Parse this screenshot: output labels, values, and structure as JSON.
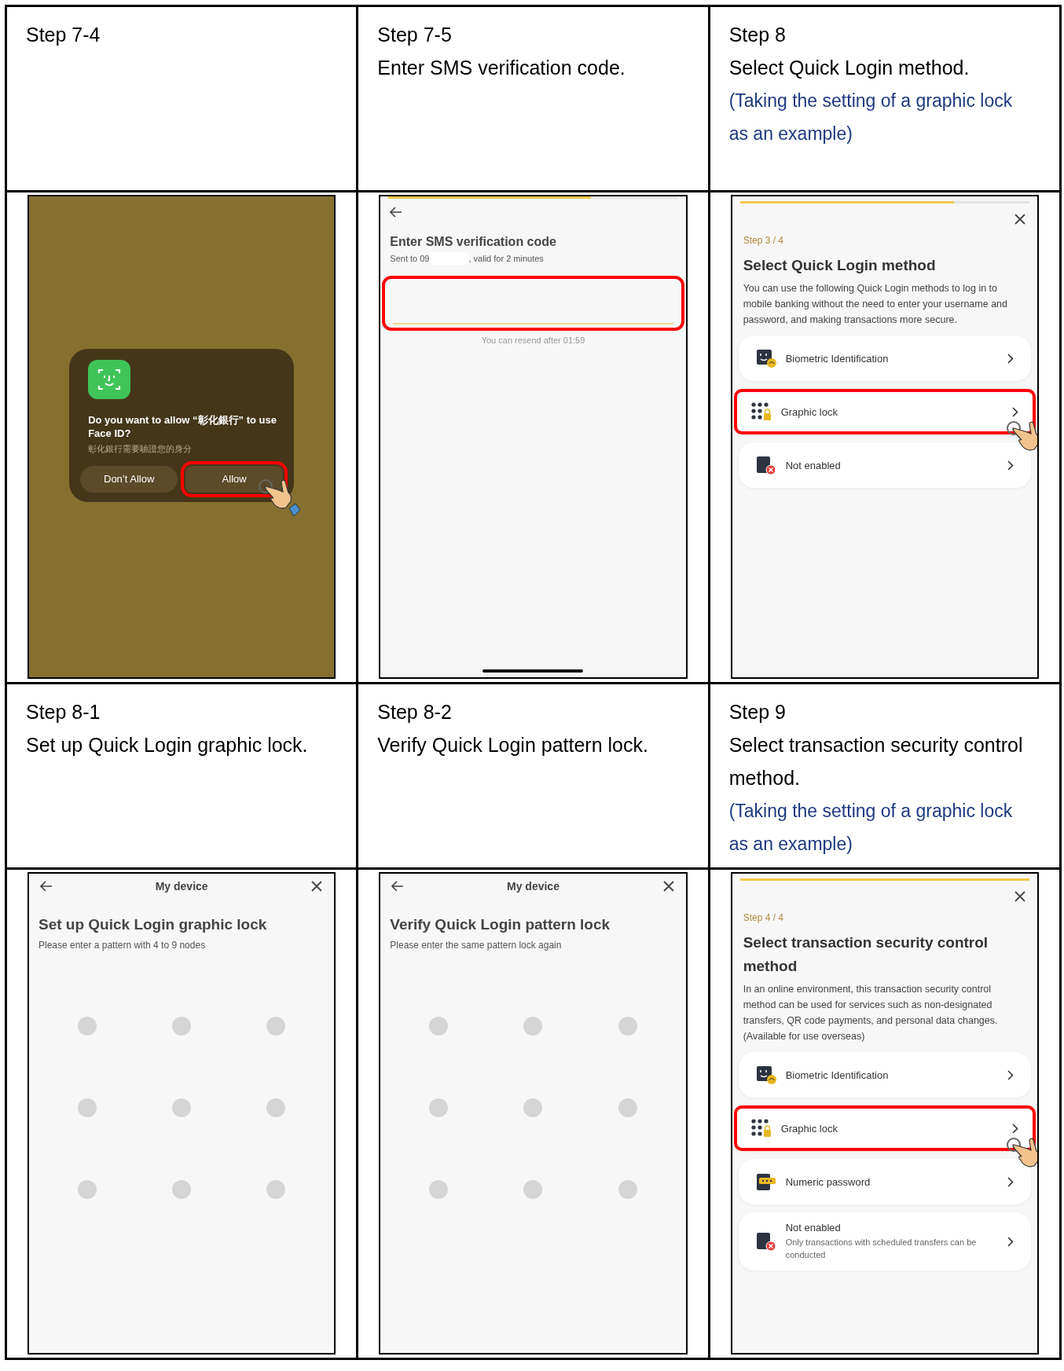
{
  "steps": [
    {
      "title": "Step 7-4",
      "screen": {
        "kind": "faceid",
        "prompt": "Do you want to allow “彰化銀行” to use Face ID?",
        "detail": "彰化銀行需要驗證您的身分",
        "buttons": [
          {
            "label": "Don’t Allow",
            "highlighted": false
          },
          {
            "label": "Allow",
            "highlighted": true
          }
        ]
      }
    },
    {
      "title": "Step 7-5",
      "instruction": "Enter SMS verification code.",
      "screen": {
        "kind": "sms",
        "progress": {
          "level": 0.7
        },
        "title": "Enter SMS verification code",
        "sent_prefix": "Sent to 09",
        "sent_suffix": ", valid for 2 minutes",
        "field_highlighted": true,
        "resend": "You can resend after 01:59"
      }
    },
    {
      "title": "Step 8",
      "instruction": "Select Quick Login method.",
      "note": "(Taking the setting of a graphic lock as an example)",
      "screen": {
        "kind": "methods",
        "progress": {
          "level": 0.74
        },
        "step_label": "Step 3 / 4",
        "title": "Select Quick Login method",
        "description": "You can use the following Quick Login methods to log in to mobile banking without the need to enter your username and password, and making transactions more secure.",
        "options": [
          {
            "kind": "biometric",
            "label": "Biometric Identification",
            "highlighted": false
          },
          {
            "kind": "pattern",
            "label": "Graphic lock",
            "highlighted": true
          },
          {
            "kind": "disabled",
            "label": "Not enabled",
            "highlighted": false
          }
        ]
      }
    },
    {
      "title": "Step 8-1",
      "instruction": "Set up Quick Login graphic lock.",
      "screen": {
        "kind": "pattern",
        "nav_title": "My device",
        "title": "Set up Quick Login graphic lock",
        "subtitle": "Please enter a pattern with 4 to 9 nodes"
      }
    },
    {
      "title": "Step 8-2",
      "instruction": "Verify Quick Login pattern lock.",
      "screen": {
        "kind": "pattern",
        "nav_title": "My device",
        "title": "Verify Quick Login pattern lock",
        "subtitle": "Please enter the same pattern lock again"
      }
    },
    {
      "title": "Step 9",
      "instruction": "Select transaction security control method.",
      "note": "(Taking the setting of a graphic lock as an example)",
      "screen": {
        "kind": "methods",
        "progress": {
          "level": 1
        },
        "step_label": "Step 4 / 4",
        "title": "Select transaction security control method",
        "description": "In an online environment, this transaction security control method can be used for services such as non-designated transfers, QR code payments, and personal data changes. (Available for use overseas)",
        "options": [
          {
            "kind": "biometric",
            "label": "Biometric Identification",
            "highlighted": false
          },
          {
            "kind": "pattern",
            "label": "Graphic lock",
            "highlighted": true
          },
          {
            "kind": "numeric",
            "label": "Numeric password",
            "highlighted": false
          },
          {
            "kind": "disabled",
            "label": "Not enabled",
            "detail": "Only transactions with scheduled transfers can be conducted",
            "highlighted": false
          }
        ]
      }
    }
  ]
}
